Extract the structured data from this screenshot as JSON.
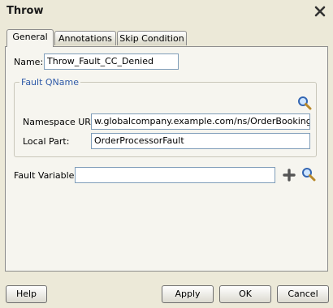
{
  "dialog": {
    "title": "Throw"
  },
  "tabs": [
    {
      "label": "General",
      "active": true
    },
    {
      "label": "Annotations",
      "active": false
    },
    {
      "label": "Skip Condition",
      "active": false
    }
  ],
  "general": {
    "name_label": "Name:",
    "name_value": "Throw_Fault_CC_Denied",
    "fault_qname_legend": "Fault QName",
    "namespace_label": "Namespace URI:",
    "namespace_value": "w.globalcompany.example.com/ns/OrderBookingService",
    "local_part_label": "Local Part:",
    "local_part_value": "OrderProcessorFault",
    "fault_variable_label": "Fault Variable:",
    "fault_variable_value": ""
  },
  "buttons": {
    "help": "Help",
    "apply": "Apply",
    "ok": "OK",
    "cancel": "Cancel"
  },
  "icons": {
    "close": "close-icon",
    "browse_qname": "search-icon",
    "add_variable": "add-icon",
    "browse_variable": "search-icon"
  },
  "colors": {
    "legend": "#2f5aa8",
    "background": "#ece9d8"
  }
}
